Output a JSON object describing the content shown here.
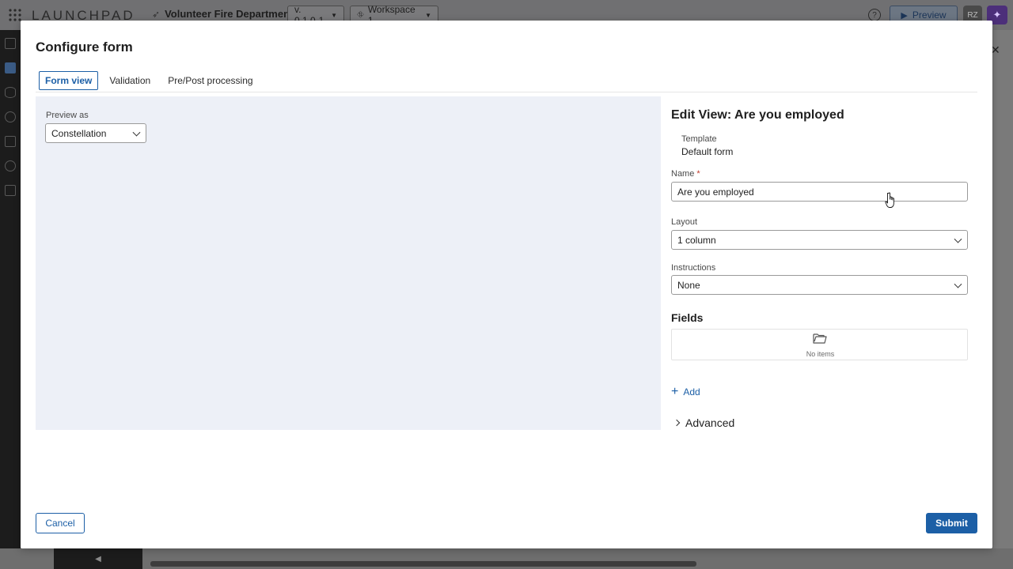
{
  "app": {
    "logo": "LAUNCHPAD",
    "project_name": "Volunteer Fire Department",
    "version": "v. 0.1.0-1",
    "workspace": "Workspace 1",
    "help_glyph": "?",
    "preview_label": "Preview",
    "avatar_initials": "RZ",
    "icons": [
      "apps-grid-icon",
      "rocket-icon",
      "workspace-icon",
      "help-icon",
      "play-icon",
      "ai-sparkle-icon",
      "close-icon"
    ]
  },
  "modal": {
    "title": "Configure form",
    "tabs": [
      {
        "label": "Form view",
        "active": true
      },
      {
        "label": "Validation",
        "active": false
      },
      {
        "label": "Pre/Post processing",
        "active": false
      }
    ],
    "preview": {
      "label": "Preview as",
      "selected": "Constellation"
    },
    "edit": {
      "title": "Edit View: Are you employed",
      "template_label": "Template",
      "template_value": "Default form",
      "name_label": "Name",
      "name_required": "*",
      "name_value": "Are you employed",
      "layout_label": "Layout",
      "layout_value": "1 column",
      "instructions_label": "Instructions",
      "instructions_value": "None",
      "fields_heading": "Fields",
      "fields_empty": "No items",
      "add_label": "Add",
      "advanced_label": "Advanced"
    },
    "footer": {
      "cancel_label": "Cancel",
      "submit_label": "Submit"
    }
  },
  "colors": {
    "accent": "#1c5fa6",
    "preview_bg": "#edf0f7",
    "required": "#c0392b"
  }
}
